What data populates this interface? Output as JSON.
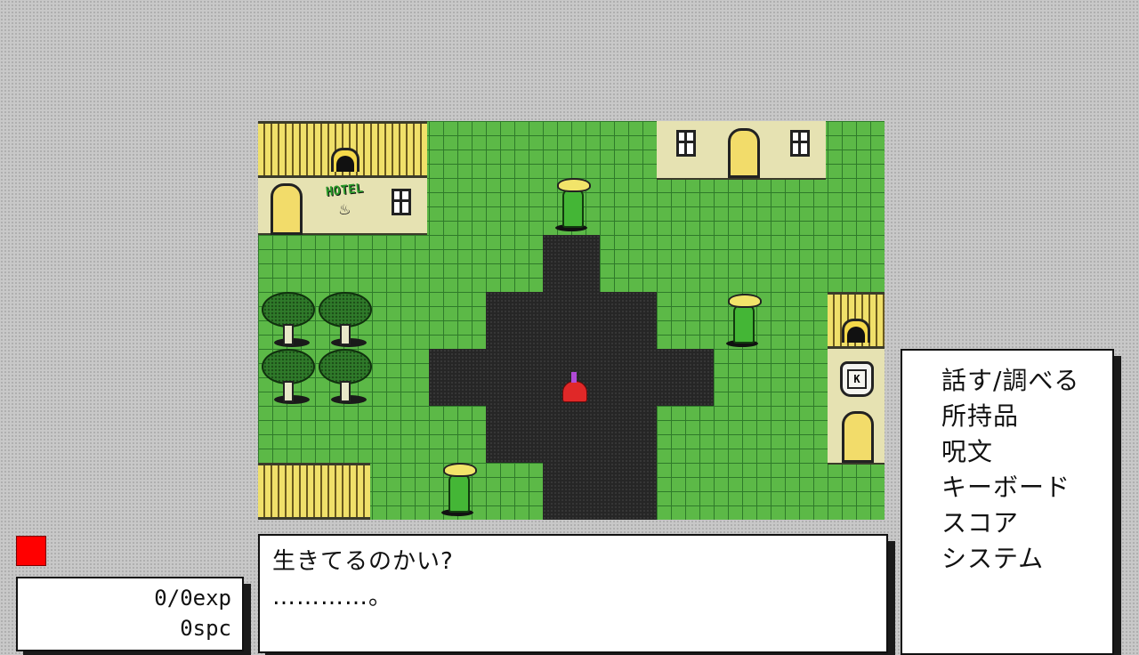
{
  "stats": {
    "exp": "0/0exp",
    "spc": "0spc"
  },
  "dialog": {
    "line1": "生きてるのかい?",
    "line2": "…………。"
  },
  "menu": {
    "items": [
      "話す/調べる",
      "所持品",
      "呪文",
      "キーボード",
      "スコア",
      "システム"
    ]
  },
  "map": {
    "hotel_sign": "HOTEL",
    "shop_sign": "K"
  },
  "colors": {
    "grass": "#5cb947",
    "status_indicator": "#ff0000",
    "building": "#e6e2b2"
  }
}
